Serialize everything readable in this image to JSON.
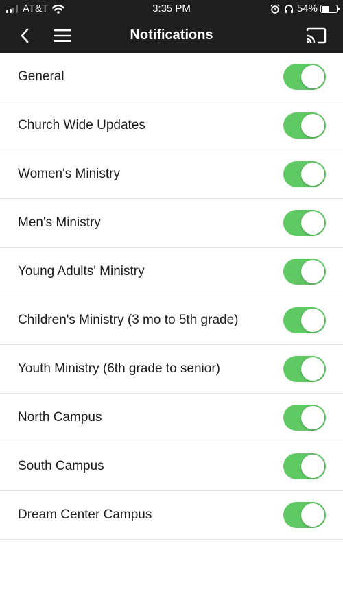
{
  "status_bar": {
    "carrier": "AT&T",
    "time": "3:35 PM",
    "battery_percent": "54%",
    "battery_level": 0.54
  },
  "nav": {
    "title": "Notifications"
  },
  "notifications": [
    {
      "label": "General",
      "enabled": true
    },
    {
      "label": "Church Wide Updates",
      "enabled": true
    },
    {
      "label": "Women's Ministry",
      "enabled": true
    },
    {
      "label": "Men's Ministry",
      "enabled": true
    },
    {
      "label": "Young Adults' Ministry",
      "enabled": true
    },
    {
      "label": "Children's Ministry (3 mo to 5th grade)",
      "enabled": true
    },
    {
      "label": "Youth Ministry (6th grade to senior)",
      "enabled": true
    },
    {
      "label": "North Campus",
      "enabled": true
    },
    {
      "label": "South Campus",
      "enabled": true
    },
    {
      "label": "Dream Center Campus",
      "enabled": true
    }
  ],
  "colors": {
    "toggle_on": "#5fc964",
    "bar_background": "#1e1e1e"
  }
}
